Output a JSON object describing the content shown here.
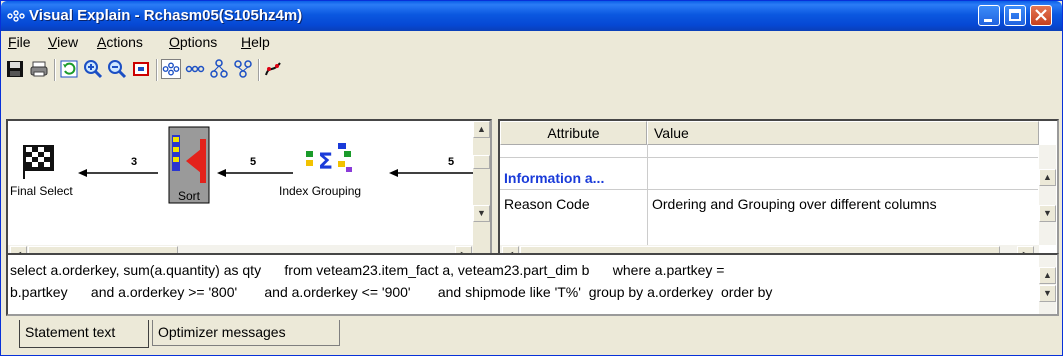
{
  "window": {
    "title": "Visual Explain - Rchasm05(S105hz4m)"
  },
  "menu": [
    {
      "label": "File",
      "mnemonic": "F",
      "rest": "ile"
    },
    {
      "label": "View",
      "mnemonic": "V",
      "rest": "iew"
    },
    {
      "label": "Actions",
      "mnemonic": "A",
      "rest": "ctions"
    },
    {
      "label": "Options",
      "mnemonic": "O",
      "rest": "ptions"
    },
    {
      "label": "Help",
      "mnemonic": "H",
      "rest": "elp"
    }
  ],
  "toolbar": {
    "icons": [
      "save-icon",
      "print-icon",
      "refresh-icon",
      "zoom-in-icon",
      "zoom-out-icon",
      "zoom-fit-icon",
      "horizontal-layout-icon",
      "vertical-layout-icon",
      "tree-icon",
      "hierarchy-icon",
      "statistics-icon"
    ]
  },
  "graph": {
    "nodes": {
      "final_select": "Final Select",
      "sort": "Sort",
      "index_grouping": "Index Grouping"
    },
    "edges": {
      "e1": "3",
      "e2": "5",
      "e3": "5"
    }
  },
  "attributes": {
    "headers": {
      "attribute": "Attribute",
      "value": "Value"
    },
    "section": "Information a...",
    "rows": [
      {
        "attribute": "Reason Code",
        "value": "Ordering and Grouping over different columns"
      }
    ]
  },
  "statement": {
    "line1": "select a.orderkey, sum(a.quantity) as qty      from veteam23.item_fact a, veteam23.part_dim b      where a.partkey =",
    "line2": "b.partkey      and a.orderkey >= '800'       and a.orderkey <= '900'       and shipmode like 'T%'  group by a.orderkey  order by"
  },
  "tabs": {
    "statement_text": "Statement text",
    "optimizer_messages": "Optimizer messages"
  },
  "colors": {
    "titlebar": "#0a5fe7",
    "section_text": "#1a3bd9",
    "sort_node": "#9a9a9a"
  }
}
